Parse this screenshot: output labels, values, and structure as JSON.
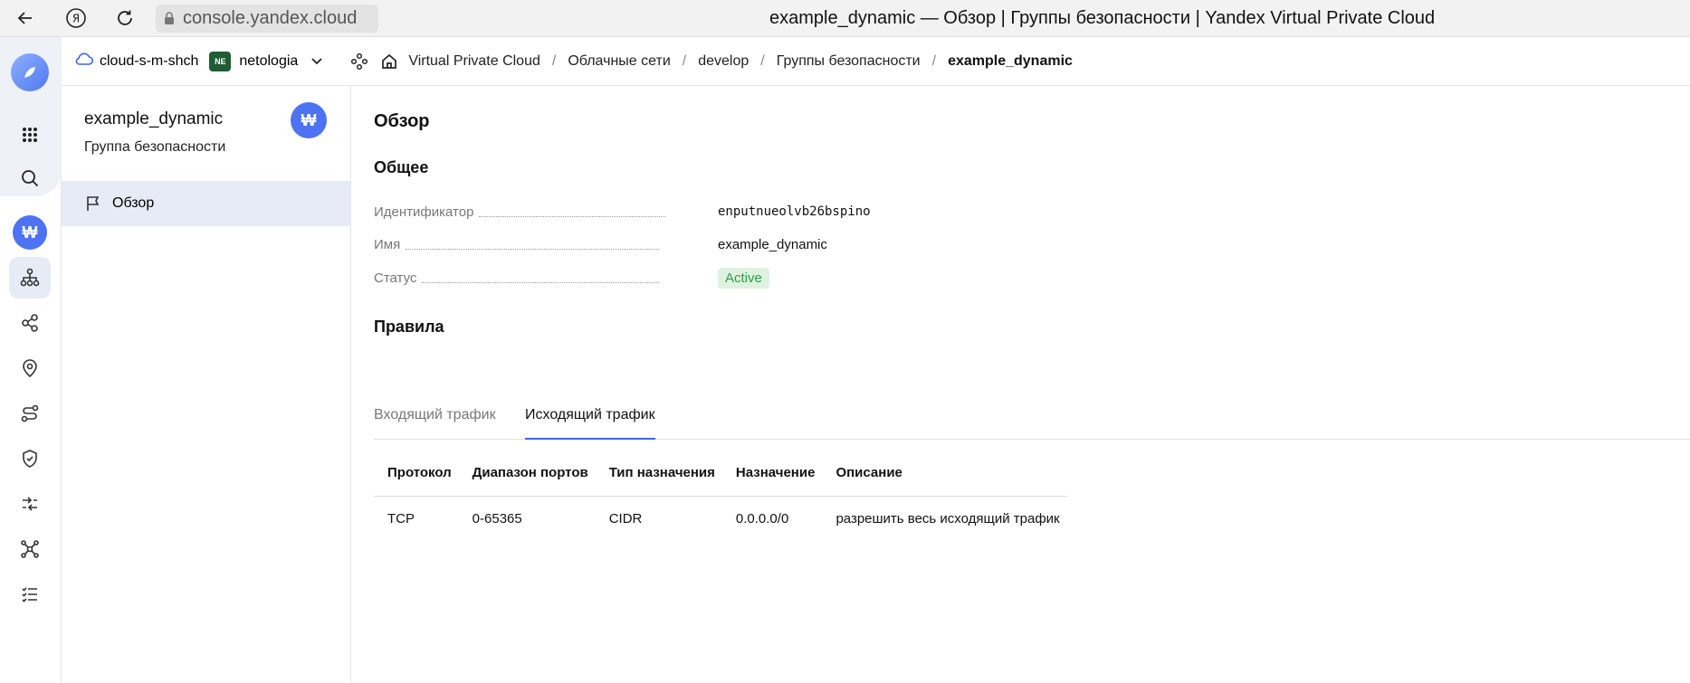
{
  "browser": {
    "url": "console.yandex.cloud",
    "page_title": "example_dynamic — Обзор | Группы безопасности | Yandex Virtual Private Cloud"
  },
  "header": {
    "cloud": "cloud-s-m-shch",
    "folder_badge": "NE",
    "folder": "netologia",
    "breadcrumbs": [
      "Virtual Private Cloud",
      "Облачные сети",
      "develop",
      "Группы безопасности",
      "example_dynamic"
    ]
  },
  "sidebar": {
    "title": "example_dynamic",
    "subtitle": "Группа безопасности",
    "nav": [
      {
        "label": "Обзор",
        "active": true
      }
    ]
  },
  "main": {
    "heading": "Обзор",
    "general_heading": "Общее",
    "fields": [
      {
        "label": "Идентификатор",
        "value": "enputnueolvb26bspino"
      },
      {
        "label": "Имя",
        "value": "example_dynamic"
      },
      {
        "label": "Статус",
        "value": "Active"
      }
    ],
    "rules_heading": "Правила",
    "tabs": [
      {
        "label": "Входящий трафик",
        "active": false
      },
      {
        "label": "Исходящий трафик",
        "active": true
      }
    ],
    "table": {
      "columns": [
        "Протокол",
        "Диапазон портов",
        "Тип назначения",
        "Назначение",
        "Описание"
      ],
      "rows": [
        [
          "TCP",
          "0-65365",
          "CIDR",
          "0.0.0.0/0",
          "разрешить весь исходящий трафик"
        ]
      ]
    }
  },
  "colors": {
    "accent": "#3b66e6",
    "status_active_bg": "#dff2df",
    "status_active_text": "#2e9e45",
    "folder_badge_bg": "#1f5c34",
    "nav_active_bg": "#e6ebf6"
  }
}
